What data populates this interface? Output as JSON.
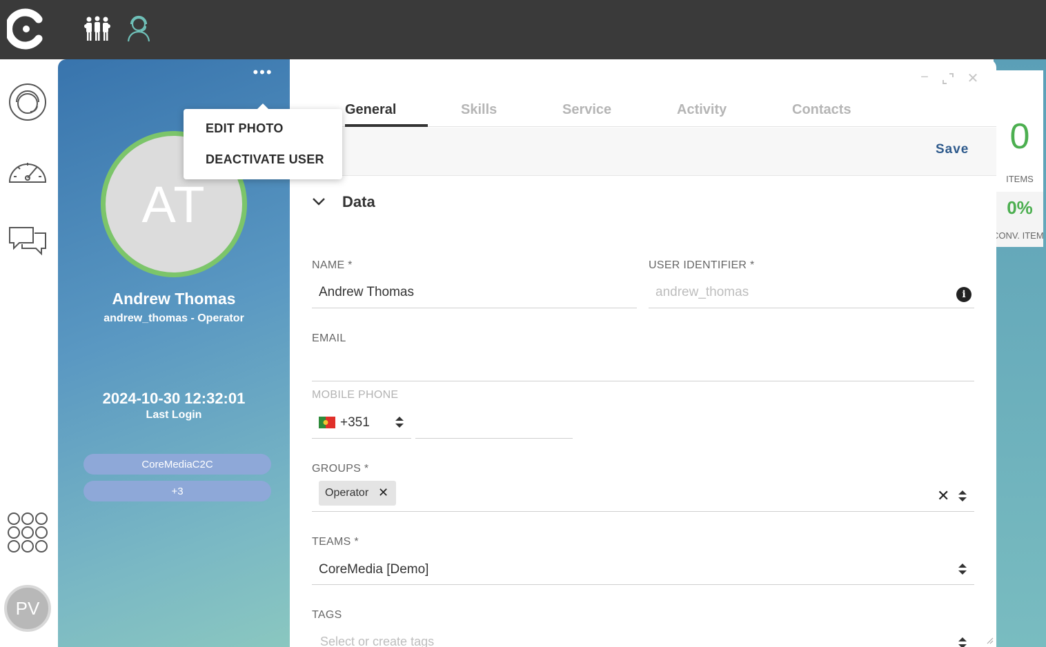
{
  "profile": {
    "initials": "AT",
    "name": "Andrew Thomas",
    "subtitle": "andrew_thomas - Operator",
    "last_login_value": "2024-10-30 12:32:01",
    "last_login_label": "Last Login",
    "chips": [
      "CoreMediaC2C",
      "+3"
    ],
    "more_label": "•••"
  },
  "menu": {
    "items": [
      "EDIT PHOTO",
      "DEACTIVATE USER"
    ]
  },
  "tabs": [
    "General",
    "Skills",
    "Service",
    "Activity",
    "Contacts"
  ],
  "active_tab": "General",
  "save_label": "Save",
  "section": {
    "title": "Data"
  },
  "fields": {
    "name": {
      "label": "NAME *",
      "value": "Andrew Thomas"
    },
    "user_identifier": {
      "label": "USER IDENTIFIER *",
      "placeholder": "andrew_thomas"
    },
    "email": {
      "label": "EMAIL",
      "value": ""
    },
    "mobile_phone": {
      "label": "MOBILE PHONE",
      "country_code": "+351",
      "number": ""
    },
    "groups": {
      "label": "GROUPS *",
      "tags": [
        "Operator"
      ]
    },
    "teams": {
      "label": "TEAMS *",
      "value": "CoreMedia [Demo]"
    },
    "tags": {
      "label": "TAGS",
      "placeholder": "Select or create tags"
    }
  },
  "user_avatar_initials": "PV",
  "stats": [
    {
      "value": "0",
      "label": "ITEMS"
    },
    {
      "value": "0%",
      "label": "CONV. ITEM"
    }
  ],
  "window_controls": {
    "minimize": "−",
    "close": "✕"
  },
  "colors": {
    "topbar": "#3a3a3a",
    "accent_green": "#7cc56a",
    "save_blue": "#2e5a8c",
    "chip": "#8ea8d8"
  }
}
